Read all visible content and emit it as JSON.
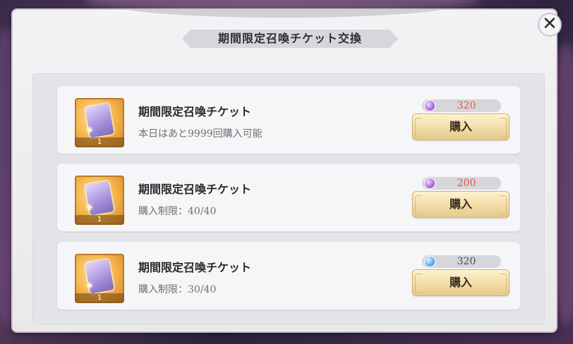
{
  "dialog": {
    "title": "期間限定召喚チケット交換",
    "close_label": "✕"
  },
  "items": [
    {
      "name": "期間限定召喚チケット",
      "limit_text": "本日はあと9999回購入可能",
      "count": "1",
      "price": "320",
      "price_color": "#e25545",
      "gem_icon": "purple-gem-icon",
      "buy_label": "購入"
    },
    {
      "name": "期間限定召喚チケット",
      "limit_text": "購入制限：40/40",
      "count": "1",
      "price": "200",
      "price_color": "#e25545",
      "gem_icon": "purple-gem-icon",
      "buy_label": "購入"
    },
    {
      "name": "期間限定召喚チケット",
      "limit_text": "購入制限：30/40",
      "count": "1",
      "price": "320",
      "price_color": "#4a4a50",
      "gem_icon": "blue-gem-icon",
      "buy_label": "購入"
    }
  ]
}
